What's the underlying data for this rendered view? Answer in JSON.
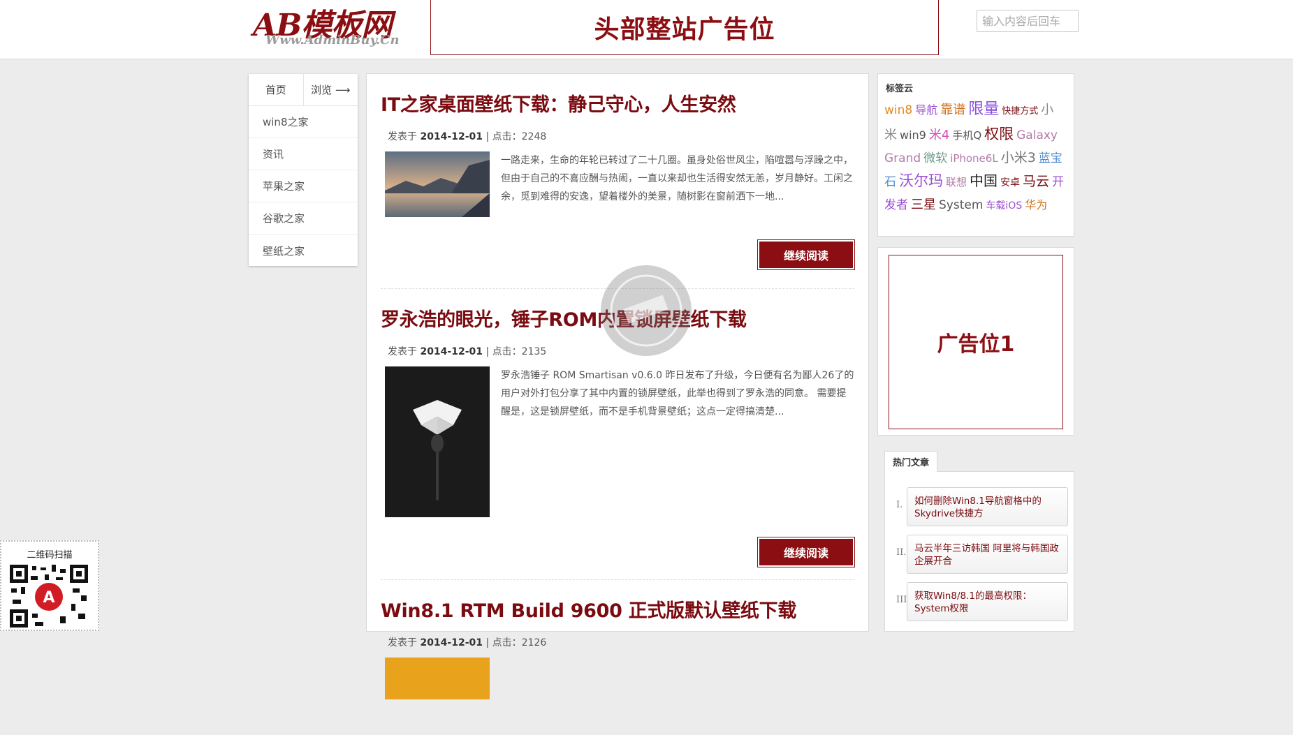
{
  "header": {
    "logo_text": "AB模板网",
    "logo_sub": "Www.AdminBuy.Cn",
    "ad_text": "头部整站广告位",
    "search_placeholder": "输入内容后回车"
  },
  "nav": {
    "home": "首页",
    "browse": "浏览 ⟶",
    "items": [
      "win8之家",
      "资讯",
      "苹果之家",
      "谷歌之家",
      "壁纸之家"
    ]
  },
  "articles": [
    {
      "title": "IT之家桌面壁纸下载：静己守心，人生安然",
      "meta_prefix": "发表于",
      "date": "2014-12-01",
      "sep": "|",
      "clicks_label": "点击：",
      "clicks": "2248",
      "summary": "一路走来，生命的年轮已转过了二十几圈。虽身处俗世风尘，陷喧嚣与浮躁之中，但由于自己的不喜应酬与热闹，一直以来却也生活得安然无恙，岁月静好。工闲之余，觅到难得的安逸，望着楼外的美景，随树影在窗前洒下一地...",
      "more": "继续阅读"
    },
    {
      "title": "罗永浩的眼光，锤子ROM内置锁屏壁纸下载",
      "meta_prefix": "发表于",
      "date": "2014-12-01",
      "sep": "|",
      "clicks_label": "点击：",
      "clicks": "2135",
      "summary": "罗永浩锤子 ROM Smartisan v0.6.0 昨日发布了升级，今日便有名为鄙人26了的用户对外打包分享了其中内置的锁屏壁纸，此举也得到了罗永浩的同意。 需要提醒是，这是锁屏壁纸，而不是手机背景壁纸；这点一定得搞清楚...",
      "more": "继续阅读"
    },
    {
      "title": "Win8.1 RTM Build 9600 正式版默认壁纸下载",
      "meta_prefix": "发表于",
      "date": "2014-12-01",
      "sep": "|",
      "clicks_label": "点击：",
      "clicks": "2126"
    }
  ],
  "tagcloud": {
    "title": "标签云",
    "tags": [
      {
        "t": "win8",
        "c": "#e08a1e",
        "s": 17
      },
      {
        "t": "导航",
        "c": "#9b4fd1",
        "s": 16
      },
      {
        "t": "靠谱",
        "c": "#d0721c",
        "s": 18
      },
      {
        "t": "限量",
        "c": "#8a4fe0",
        "s": 22
      },
      {
        "t": "快捷方式",
        "c": "#7a0b10",
        "s": 13
      },
      {
        "t": "小米",
        "c": "#888888",
        "s": 18
      },
      {
        "t": "win9",
        "c": "#555555",
        "s": 16
      },
      {
        "t": "米4",
        "c": "#d14fb5",
        "s": 18
      },
      {
        "t": "手机Q",
        "c": "#555555",
        "s": 15
      },
      {
        "t": "权限",
        "c": "#7a0b10",
        "s": 21
      },
      {
        "t": "Galaxy Grand",
        "c": "#b27aa8",
        "s": 17
      },
      {
        "t": "微软",
        "c": "#6c9a8a",
        "s": 17
      },
      {
        "t": "iPhone6L",
        "c": "#b27aa8",
        "s": 15
      },
      {
        "t": "小米3",
        "c": "#777777",
        "s": 19
      },
      {
        "t": "蓝宝石",
        "c": "#4f8ad1",
        "s": 17
      },
      {
        "t": "沃尔玛",
        "c": "#9b4fd1",
        "s": 21
      },
      {
        "t": "联想",
        "c": "#b27aa8",
        "s": 15
      },
      {
        "t": "中国",
        "c": "#222222",
        "s": 20
      },
      {
        "t": "安卓",
        "c": "#7a0b10",
        "s": 14
      },
      {
        "t": "马云",
        "c": "#7a0b10",
        "s": 19
      },
      {
        "t": "开发者",
        "c": "#9b4fd1",
        "s": 17
      },
      {
        "t": "三星",
        "c": "#7a0b10",
        "s": 18
      },
      {
        "t": "System",
        "c": "#555555",
        "s": 17
      },
      {
        "t": "车载iOS",
        "c": "#9b4fd1",
        "s": 14
      },
      {
        "t": "华为",
        "c": "#d0721c",
        "s": 16
      }
    ]
  },
  "sidebar_ad": "广告位1",
  "hot": {
    "tab": "热门文章",
    "items": [
      {
        "num": "I.",
        "title": "如何删除Win8.1导航窗格中的Skydrive快捷方"
      },
      {
        "num": "II.",
        "title": "马云半年三访韩国 阿里将与韩国政企展开合"
      },
      {
        "num": "III.",
        "title": "获取Win8/8.1的最高权限：System权限"
      }
    ]
  },
  "qr": {
    "label": "二维码扫描"
  },
  "colors": {
    "brand": "#8b0e12",
    "bg": "#ececec"
  }
}
